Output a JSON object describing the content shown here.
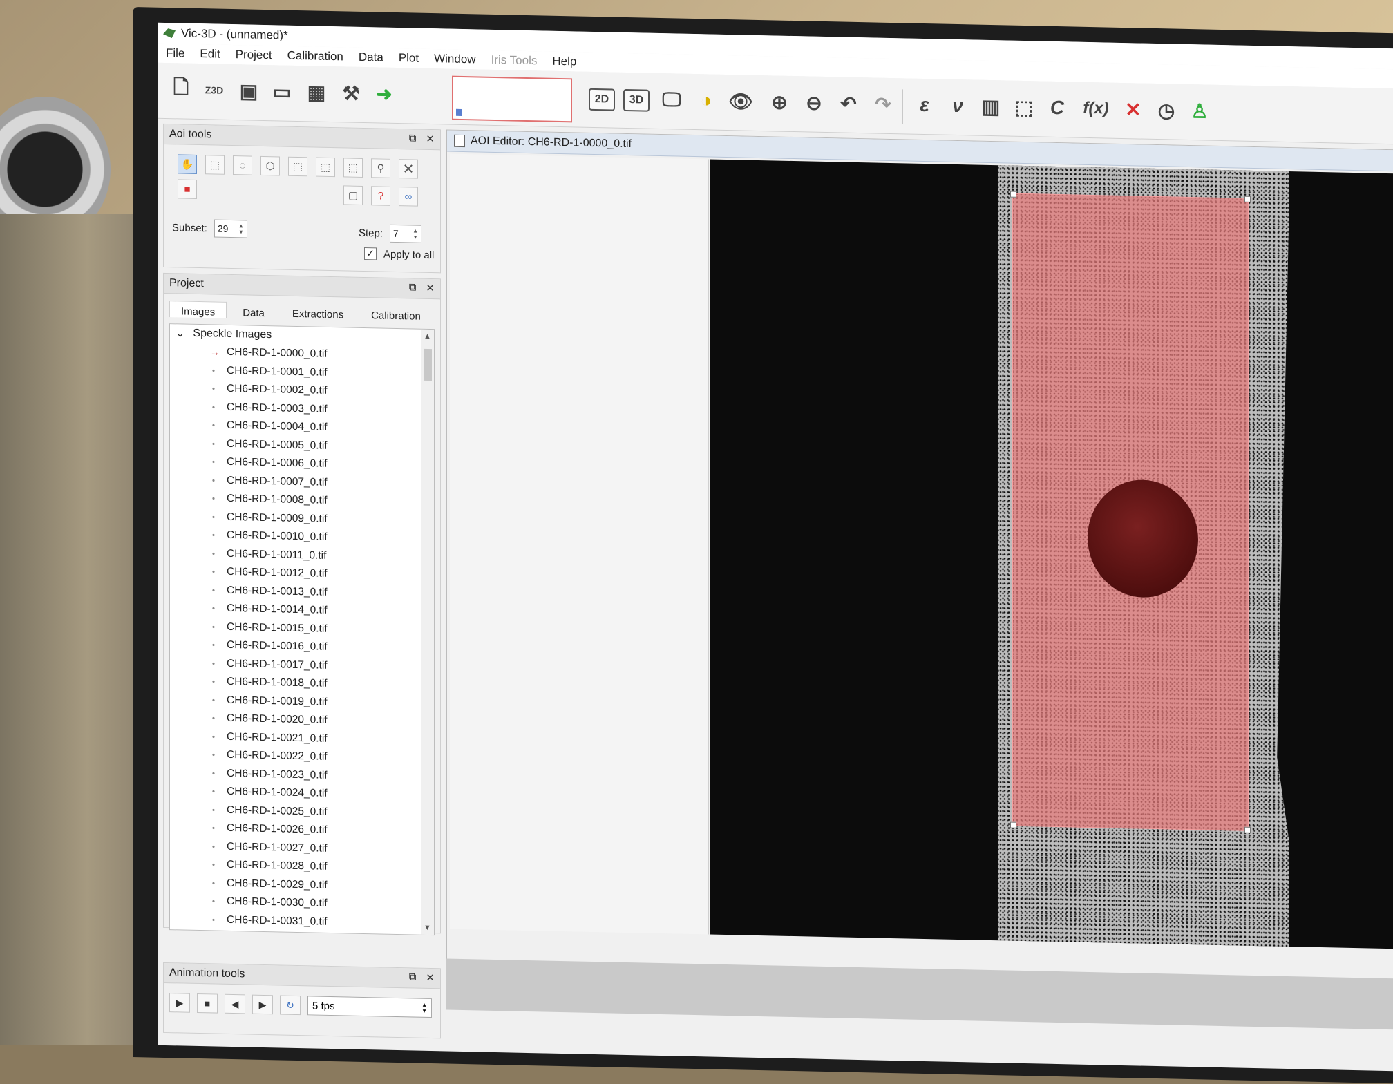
{
  "window": {
    "title": "Vic-3D - (unnamed)*"
  },
  "menu": [
    "File",
    "Edit",
    "Project",
    "Calibration",
    "Data",
    "Plot",
    "Window",
    "Iris Tools",
    "Help"
  ],
  "toolbar": {
    "mode_2d": "2D",
    "mode_3d": "3D",
    "symbols": {
      "epsilon": "ε",
      "nu": "ν",
      "c": "C",
      "fx": "f(x)"
    }
  },
  "aoi_tools": {
    "title": "Aoi tools",
    "subset_label": "Subset:",
    "subset_value": "29",
    "step_label": "Step:",
    "step_value": "7",
    "apply_all_label": "Apply to all",
    "apply_all_checked": true
  },
  "project": {
    "title": "Project",
    "tabs": [
      "Images",
      "Data",
      "Extractions",
      "Calibration"
    ],
    "active_tab": "Images",
    "root": "Speckle Images",
    "files": [
      "CH6-RD-1-0000_0.tif",
      "CH6-RD-1-0001_0.tif",
      "CH6-RD-1-0002_0.tif",
      "CH6-RD-1-0003_0.tif",
      "CH6-RD-1-0004_0.tif",
      "CH6-RD-1-0005_0.tif",
      "CH6-RD-1-0006_0.tif",
      "CH6-RD-1-0007_0.tif",
      "CH6-RD-1-0008_0.tif",
      "CH6-RD-1-0009_0.tif",
      "CH6-RD-1-0010_0.tif",
      "CH6-RD-1-0011_0.tif",
      "CH6-RD-1-0012_0.tif",
      "CH6-RD-1-0013_0.tif",
      "CH6-RD-1-0014_0.tif",
      "CH6-RD-1-0015_0.tif",
      "CH6-RD-1-0016_0.tif",
      "CH6-RD-1-0017_0.tif",
      "CH6-RD-1-0018_0.tif",
      "CH6-RD-1-0019_0.tif",
      "CH6-RD-1-0020_0.tif",
      "CH6-RD-1-0021_0.tif",
      "CH6-RD-1-0022_0.tif",
      "CH6-RD-1-0023_0.tif",
      "CH6-RD-1-0024_0.tif",
      "CH6-RD-1-0025_0.tif",
      "CH6-RD-1-0026_0.tif",
      "CH6-RD-1-0027_0.tif",
      "CH6-RD-1-0028_0.tif",
      "CH6-RD-1-0029_0.tif",
      "CH6-RD-1-0030_0.tif",
      "CH6-RD-1-0031_0.tif"
    ],
    "current_index": 0
  },
  "animation": {
    "title": "Animation tools",
    "fps": "5 fps"
  },
  "editor": {
    "title": "AOI Editor: CH6-RD-1-0000_0.tif"
  },
  "colors": {
    "aoi_fill": "#e67878",
    "accent_green": "#2fae3c",
    "delete_red": "#d83030"
  }
}
